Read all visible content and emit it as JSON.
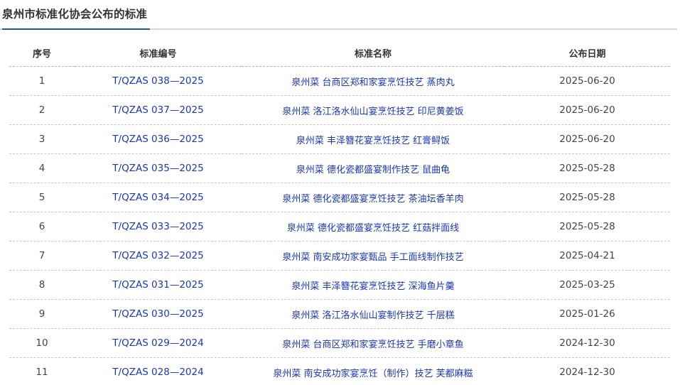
{
  "header": {
    "title": "泉州市标准化协会公布的标准"
  },
  "table": {
    "columns": [
      "序号",
      "标准编号",
      "标准名称",
      "公布日期"
    ],
    "rows": [
      {
        "seq": "1",
        "code": "T/QZAS 038—2025",
        "name": "泉州菜 台商区郑和家宴烹饪技艺 蒸肉丸",
        "date": "2025-06-20"
      },
      {
        "seq": "2",
        "code": "T/QZAS 037—2025",
        "name": "泉州菜 洛江洛水仙山宴烹饪技艺 印尼黄姜饭",
        "date": "2025-06-20"
      },
      {
        "seq": "3",
        "code": "T/QZAS 036—2025",
        "name": "泉州菜 丰泽簪花宴烹饪技艺 红膏鲟饭",
        "date": "2025-06-20"
      },
      {
        "seq": "4",
        "code": "T/QZAS 035—2025",
        "name": "泉州菜 德化瓷都盛宴制作技艺 鼠曲龟",
        "date": "2025-05-28"
      },
      {
        "seq": "5",
        "code": "T/QZAS 034—2025",
        "name": "泉州菜 德化瓷都盛宴烹饪技艺 茶油坛香羊肉",
        "date": "2025-05-28"
      },
      {
        "seq": "6",
        "code": "T/QZAS 033—2025",
        "name": "泉州菜 德化瓷都盛宴烹饪技艺 红菇拌面线",
        "date": "2025-05-28"
      },
      {
        "seq": "7",
        "code": "T/QZAS 032—2025",
        "name": "泉州菜 南安成功家宴甄品 手工面线制作技艺",
        "date": "2025-04-21"
      },
      {
        "seq": "8",
        "code": "T/QZAS 031—2025",
        "name": "泉州菜 丰泽簪花宴烹饪技艺 深海鱼片羹",
        "date": "2025-03-25"
      },
      {
        "seq": "9",
        "code": "T/QZAS 030—2025",
        "name": "泉州菜 洛江洛水仙山宴制作技艺 千层糕",
        "date": "2025-01-26"
      },
      {
        "seq": "10",
        "code": "T/QZAS 029—2024",
        "name": "泉州菜 台商区郑和家宴烹饪技艺 手磨小章鱼",
        "date": "2024-12-30"
      },
      {
        "seq": "11",
        "code": "T/QZAS 028—2024",
        "name": "泉州菜 南安成功家宴烹饪（制作）技艺 芙都麻糍",
        "date": "2024-12-30"
      }
    ]
  },
  "colors": {
    "accent": "#1b5a8a",
    "link": "#1a37b8",
    "divider": "#d3d6da"
  }
}
